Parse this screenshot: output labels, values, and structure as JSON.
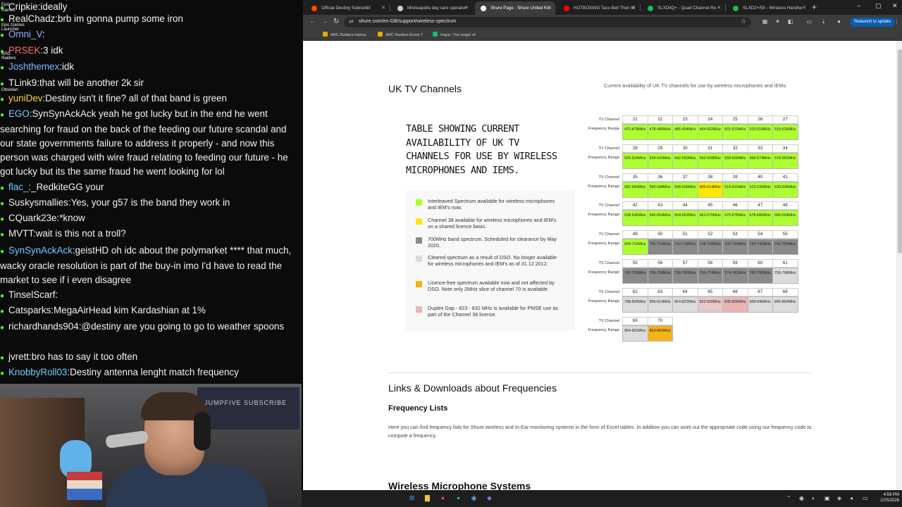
{
  "chat": {
    "lines": [
      {
        "user": "Cripkie",
        "user_color": "#f2f2f2",
        "sep": ":",
        "msg": "ideally"
      },
      {
        "user": "RealChadz",
        "user_color": "#f2f2f2",
        "sep": ":",
        "msg": "brb im gonna pump some iron"
      },
      {
        "user": "Omni_V",
        "user_color": "#8fb3ff",
        "sep": ":",
        "msg": ""
      },
      {
        "user": "PRSEK",
        "user_color": "#ff6b6b",
        "sep": ":",
        "msg": "3 idk"
      },
      {
        "user": "Joshthemex",
        "user_color": "#7fb7ff",
        "sep": ":",
        "msg": "idk"
      },
      {
        "user": "TLink9",
        "user_color": "#f2f2f2",
        "sep": ":",
        "msg": "that will be another 2k sir"
      },
      {
        "user": "yuniDev",
        "user_color": "#ffd43b",
        "sep": ":",
        "msg": "Destiny  isn't it fine? all of that band is green"
      },
      {
        "user": "EGO",
        "user_color": "#6fd0ff",
        "sep": ":",
        "msg": "SynSynAckAck yeah he got lucky but in the end he went searching for fraud on the back of the feeding our future scandal and our state governments failure to address it properly - and now this person was charged with wire fraud relating to feeding our future - he got lucky but its the same fraud he went looking for lol"
      },
      {
        "user": "flac_",
        "user_color": "#6fd0ff",
        "sep": ":",
        "msg": "_RedkiteGG your"
      },
      {
        "user": "Suskysmallies",
        "user_color": "#f2f2f2",
        "sep": ":",
        "msg": "Yes, your g57 is the band they work in"
      },
      {
        "user": "CQuark23e",
        "user_color": "#f2f2f2",
        "sep": ":",
        "msg": "*know"
      },
      {
        "user": "MVTT",
        "user_color": "#f2f2f2",
        "sep": ":",
        "msg": "wait is this not a troll?"
      },
      {
        "user": "SynSynAckAck",
        "user_color": "#6fd0ff",
        "sep": ":",
        "msg": "geistHD oh idc about the polymarket **** that much, wacky oracle resolution is part of the buy-in imo  I'd have to read the market to see if i even disagree"
      },
      {
        "user": "TinselScarf",
        "user_color": "#f2f2f2",
        "sep": ":",
        "msg": ""
      },
      {
        "user": "Catsparks",
        "user_color": "#f2f2f2",
        "sep": ":",
        "msg": "MegaAirHead kim Kardashian at 1%"
      },
      {
        "user": "richardhands904",
        "user_color": "#f2f2f2",
        "sep": ":",
        "msg": "@destiny are you going to go to weather spoons"
      },
      {
        "user": "jvrett",
        "user_color": "#f2f2f2",
        "sep": ":",
        "msg": "bro has to say it too often"
      },
      {
        "user": "KnobbyRoll03",
        "user_color": "#6fd0ff",
        "sep": ":",
        "msg": "Destiny antenna lenght match frequency"
      }
    ],
    "desktop_labels": [
      "Epic",
      "Games",
      "Epic Games Launcher",
      "ARC Raiders",
      "Obsidian"
    ]
  },
  "webcam": {
    "sign_text": "JUMPFIVE SUBSCRIBE"
  },
  "browser": {
    "tabs": [
      {
        "label": "Official Destiny Subreddit",
        "color": "#ff4500",
        "active": false
      },
      {
        "label": "Minneapolis day care operator",
        "color": "#cccccc",
        "active": false
      },
      {
        "label": "Shure Page - Shure United Kin",
        "color": "#ffffff",
        "active": true
      },
      {
        "label": "HOTBOXING Taco Bell Then W",
        "color": "#ff0000",
        "active": false
      },
      {
        "label": "SLXD4Q+ - Quad Channel Re",
        "color": "#1db954",
        "active": false
      },
      {
        "label": "SLXD2+/58 - Wireless Handhe",
        "color": "#1db954",
        "active": false
      }
    ],
    "new_tab": "+",
    "window_controls": [
      "–",
      "▢",
      "✕"
    ],
    "url": "shure.com/en-GB/support/wireless-spectrum",
    "relaunch_label": "Relaunch to update",
    "bookmarks": [
      {
        "label": "ARC Raiders Interac",
        "color": "#e0b000"
      },
      {
        "label": "ARC Raiders Event T",
        "color": "#e0b000"
      },
      {
        "label": "Imgur: The magic of",
        "color": "#1bb76e"
      }
    ]
  },
  "page": {
    "uk_heading": "UK TV Channels",
    "uk_subtitle": "Current availability of UK TV channels for use by wireless microphones and IEMs.",
    "legend_title": "TABLE SHOWING CURRENT AVAILABILITY OF UK TV CHANNELS FOR USE BY WIRELESS MICROPHONES AND IEMS.",
    "legend": [
      {
        "color": "#adff2f",
        "text": "Interleaved Spectrum available for wireless microphones and IEM's now."
      },
      {
        "color": "#ffe800",
        "text": "Channel 38 available for wireless microphones and IEM's on a shared licence basis."
      },
      {
        "color": "#8a8a8a",
        "text": "700MHz band spectrum. Scheduled for clearance by May 2020."
      },
      {
        "color": "#dcdcdc",
        "text": "Cleared spectrum as a result of DSO. No longer available for wireless microphones and IEM's as of 31.12.2012."
      },
      {
        "color": "#f5b31b",
        "text": "Licence-free spectrum available now and not affected by DSO.  Note only 2MHz slice of channel 70 is available."
      },
      {
        "color": "#e9b5b5",
        "text": "Duplex Gap - 823 - 832 MHz is available for PMSE use as part of the Channel 38 license."
      }
    ],
    "channel_label": "TV Channel",
    "freq_label": "Frequency Range",
    "channel_rows": [
      {
        "channels": [
          "21",
          "22",
          "23",
          "24",
          "25",
          "26",
          "27"
        ],
        "freqs": [
          "470-478MHz",
          "478-486MHz",
          "486-494MHz",
          "494-502MHz",
          "502-510MHz",
          "510-518MHz",
          "518-526MHz"
        ],
        "status": [
          "g",
          "g",
          "g",
          "g",
          "g",
          "g",
          "g"
        ]
      },
      {
        "channels": [
          "28",
          "29",
          "30",
          "31",
          "32",
          "33",
          "34"
        ],
        "freqs": [
          "526-534MHz",
          "534-542MHz",
          "542-550MHz",
          "550-558MHz",
          "558-566MHz",
          "566-574MHz",
          "574-582MHz"
        ],
        "status": [
          "g",
          "g",
          "g",
          "g",
          "g",
          "g",
          "g"
        ]
      },
      {
        "channels": [
          "35",
          "36",
          "37",
          "38",
          "39",
          "40",
          "41"
        ],
        "freqs": [
          "582-590MHz",
          "590-598MHz",
          "598-606MHz",
          "606-614MHz",
          "614-622MHz",
          "622-630MHz",
          "630-638MHz"
        ],
        "status": [
          "g",
          "g",
          "g",
          "y",
          "g",
          "g",
          "g"
        ]
      },
      {
        "channels": [
          "42",
          "43",
          "44",
          "45",
          "46",
          "47",
          "48"
        ],
        "freqs": [
          "638-646MHz",
          "646-654MHz",
          "654-662MHz",
          "662-670MHz",
          "670-678MHz",
          "678-686MHz",
          "686-694MHz"
        ],
        "status": [
          "g",
          "g",
          "g",
          "g",
          "g",
          "g",
          "g"
        ]
      },
      {
        "channels": [
          "49",
          "50",
          "51",
          "52",
          "53",
          "54",
          "55"
        ],
        "freqs": [
          "694-702MHz",
          "702-710MHz",
          "710-718MHz",
          "718-726MHz",
          "726-734MHz",
          "734-742MHz",
          "742-750MHz"
        ],
        "status": [
          "g",
          "d",
          "d",
          "d",
          "d",
          "d",
          "d"
        ]
      },
      {
        "channels": [
          "55",
          "56",
          "57",
          "58",
          "59",
          "60",
          "61"
        ],
        "freqs": [
          "742-750MHz",
          "750-758MHz",
          "758-766MHz",
          "766-774MHz",
          "774-782MHz",
          "782-790MHz",
          "790-798MHz"
        ],
        "status": [
          "d",
          "d",
          "d",
          "d",
          "d",
          "d",
          "l"
        ]
      },
      {
        "channels": [
          "62",
          "63",
          "64",
          "65",
          "66",
          "67",
          "68"
        ],
        "freqs": [
          "798-806MHz",
          "806-814MHz",
          "814-822MHz",
          "822-830MHz",
          "830-838MHz",
          "838-846MHz",
          "846-854MHz"
        ],
        "status": [
          "l",
          "l",
          "l",
          "lp",
          "p",
          "l",
          "l"
        ]
      },
      {
        "channels": [
          "69",
          "70"
        ],
        "freqs": [
          "854-862MHz",
          "863-865MHz"
        ],
        "status": [
          "l",
          "o"
        ]
      }
    ],
    "status_colors": {
      "g": "#adff2f",
      "y": "#ffe800",
      "d": "#8a8a8a",
      "l": "#dcdcdc",
      "o": "#f5b31b",
      "p": "#e9b5b5",
      "lp": "#e6c8c8"
    },
    "links_heading": "Links & Downloads about Frequencies",
    "freq_lists_heading": "Frequency Lists",
    "freq_para": "Here you can find frequency lists for Shure wireless and In-Ear-monitoring systems in the form of Excel tables. In addition you can work out the appropriate code using our frequency code to compute a frequency.",
    "wms_heading": "Wireless Microphone Systems"
  },
  "taskbar": {
    "icons": [
      {
        "name": "windows-start-icon",
        "glyph": "⊞",
        "color": "#3aa0ff"
      },
      {
        "name": "file-explorer-icon",
        "glyph": "▇",
        "color": "#f2c14e"
      },
      {
        "name": "chrome-icon",
        "glyph": "●",
        "color": "#e54b3c"
      },
      {
        "name": "spotify-icon",
        "glyph": "●",
        "color": "#1db954"
      },
      {
        "name": "steam-icon",
        "glyph": "◉",
        "color": "#6fa8dc"
      },
      {
        "name": "obsidian-icon",
        "glyph": "◆",
        "color": "#8e6ad8"
      }
    ],
    "time": "4:59 PM",
    "date": "2/25/2026"
  }
}
